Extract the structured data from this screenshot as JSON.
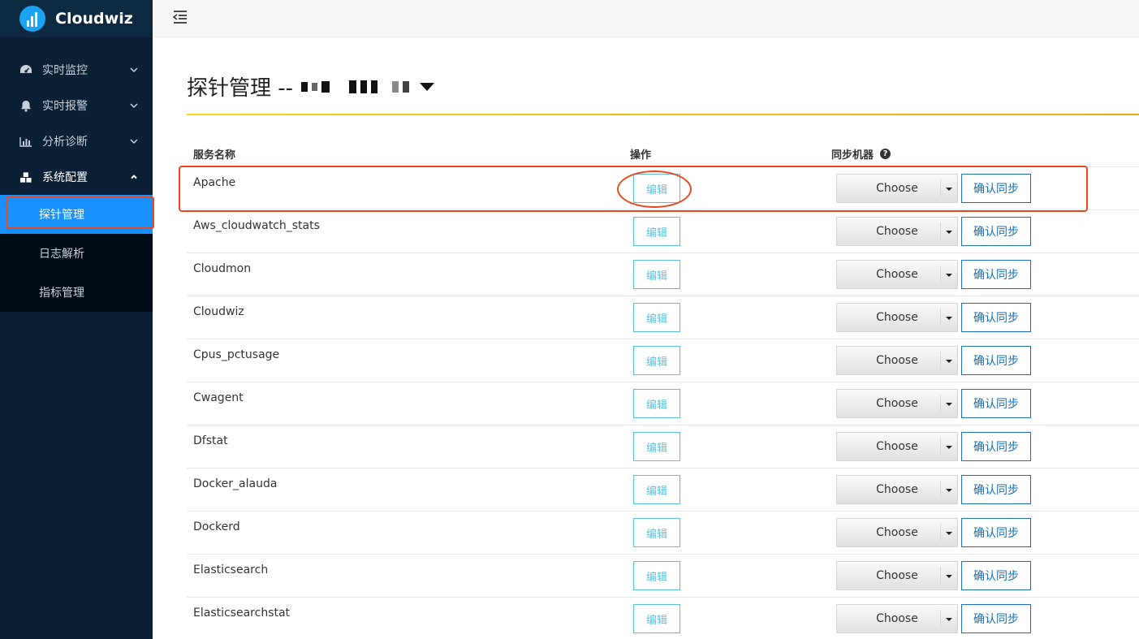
{
  "app": {
    "name": "Cloudwiz"
  },
  "sidebar": {
    "items": [
      {
        "label": "实时监控",
        "icon": "dashboard-icon",
        "expanded": false
      },
      {
        "label": "实时报警",
        "icon": "bell-icon",
        "expanded": false
      },
      {
        "label": "分析诊断",
        "icon": "bar-chart-icon",
        "expanded": false
      },
      {
        "label": "系统配置",
        "icon": "cubes-icon",
        "expanded": true
      }
    ],
    "submenu": [
      {
        "label": "探针管理",
        "active": true
      },
      {
        "label": "日志解析",
        "active": false
      },
      {
        "label": "指标管理",
        "active": false
      }
    ]
  },
  "page": {
    "title": "探针管理 --"
  },
  "table": {
    "headers": {
      "name": "服务名称",
      "operation": "操作",
      "sync": "同步机器"
    },
    "rows": [
      {
        "name": "Apache"
      },
      {
        "name": "Aws_cloudwatch_stats"
      },
      {
        "name": "Cloudmon"
      },
      {
        "name": "Cloudwiz"
      },
      {
        "name": "Cpus_pctusage"
      },
      {
        "name": "Cwagent"
      },
      {
        "name": "Dfstat"
      },
      {
        "name": "Docker_alauda"
      },
      {
        "name": "Dockerd"
      },
      {
        "name": "Elasticsearch"
      },
      {
        "name": "Elasticsearchstat"
      }
    ],
    "edit_label": "编辑",
    "select_label": "Choose",
    "confirm_label": "确认同步"
  },
  "colors": {
    "sidebar_bg": "#0b2035",
    "active_item": "#1890ff",
    "annotation": "#e8491d",
    "edit_button": "#5bc0de",
    "confirm_button": "#1a6fb5",
    "title_rule": "#f7a614"
  }
}
